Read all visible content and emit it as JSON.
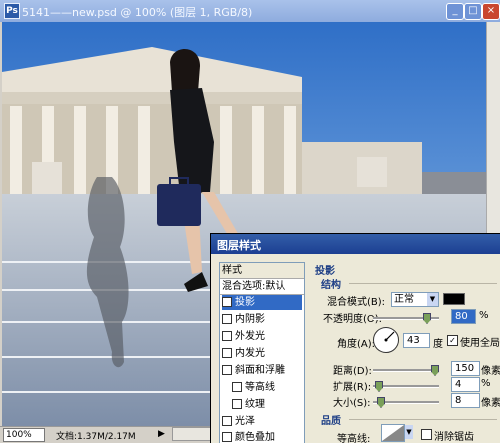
{
  "window": {
    "title": "5141——new.psd @ 100% (图层 1, RGB/8)",
    "buttons": {
      "minimize": "_",
      "maximize": "□",
      "close": "×"
    }
  },
  "status": {
    "zoom": "100%",
    "doc_info": "文档:1.37M/2.17M",
    "arrow": "▶"
  },
  "dialog": {
    "title": "图层样式",
    "styles": {
      "header": "样式",
      "blend_options": "混合选项:默认",
      "items": [
        {
          "label": "投影",
          "checked": true,
          "selected": true
        },
        {
          "label": "内阴影",
          "checked": false
        },
        {
          "label": "外发光",
          "checked": false
        },
        {
          "label": "内发光",
          "checked": false
        },
        {
          "label": "斜面和浮雕",
          "checked": false
        },
        {
          "label": "等高线",
          "checked": false,
          "sub": true
        },
        {
          "label": "纹理",
          "checked": false,
          "sub": true
        },
        {
          "label": "光泽",
          "checked": false
        },
        {
          "label": "颜色叠加",
          "checked": false
        }
      ]
    },
    "panel": {
      "section_title": "投影",
      "structure_title": "结构",
      "blend_mode_label": "混合模式(B):",
      "blend_mode_value": "正常",
      "shadow_color": "#000000",
      "opacity_label": "不透明度(O):",
      "opacity_value": "80",
      "opacity_unit": "%",
      "angle_label": "角度(A):",
      "angle_value": "43",
      "angle_unit": "度",
      "global_light_label": "使用全局光",
      "global_light_checked": true,
      "distance_label": "距离(D):",
      "distance_value": "150",
      "distance_unit": "像素",
      "spread_label": "扩展(R):",
      "spread_value": "4",
      "spread_unit": "%",
      "size_label": "大小(S):",
      "size_value": "8",
      "size_unit": "像素",
      "quality_title": "品质",
      "contour_label": "等高线:",
      "antialias_label": "消除锯齿",
      "antialias_checked": false
    }
  },
  "colors": {
    "titlebar": "#8eacde",
    "dialog_title": "#1c3f92",
    "accent": "#316ac5"
  }
}
